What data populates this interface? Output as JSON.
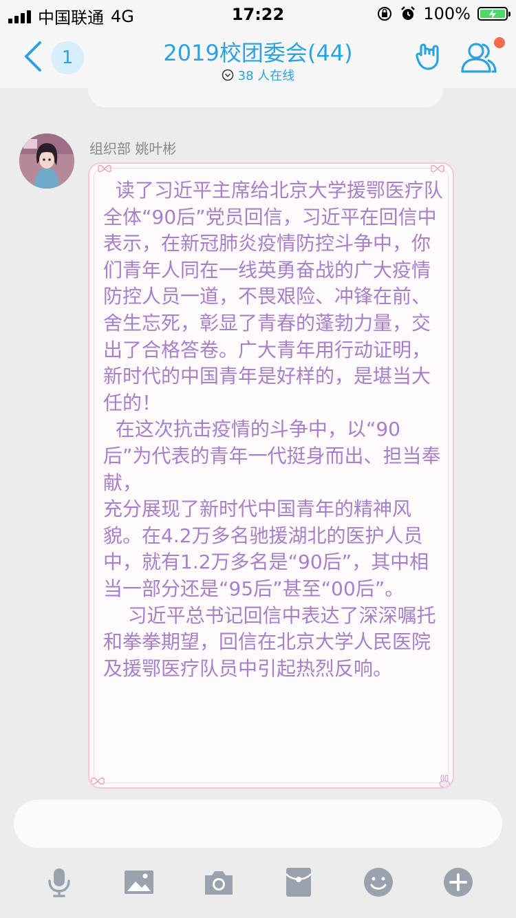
{
  "status_bar": {
    "carrier": "中国联通",
    "network": "4G",
    "time": "17:22",
    "battery": "100%"
  },
  "header": {
    "back_badge": "1",
    "title": "2019校团委会(44)",
    "online": "38 人在线"
  },
  "message": {
    "sender": "组织部 姚叶彬",
    "paragraphs": [
      "  读了习近平主席给北京大学援鄂医疗队全体“90后”党员回信，习近平在回信中表示，在新冠肺炎疫情防控斗争中，你们青年人同在一线英勇奋战的广大疫情防控人员一道，不畏艰险、冲锋在前、舍生忘死，彰显了青春的蓬勃力量，交出了合格答卷。广大青年用行动证明，新时代的中国青年是好样的，是堪当大任的！",
      "  在这次抗击疫情的斗争中，以“90后”为代表的青年一代挺身而出、担当奉献，",
      "充分展现了新时代中国青年的精神风貌。在4.2万多名驰援湖北的医护人员中，就有1.2万多名是“90后”，其中相当一部分还是“95后”甚至“00后”。",
      "    习近平总书记回信中表达了深深嘱托和拳拳期望，回信在北京大学人民医院及援鄂医疗队员中引起热烈反响。"
    ]
  },
  "toolbar": {
    "icons": [
      "microphone-icon",
      "image-icon",
      "camera-icon",
      "red-packet-icon",
      "emoji-icon",
      "plus-icon"
    ]
  },
  "colors": {
    "accent": "#2ba3e0",
    "message_text": "#a87fc9",
    "bubble_border": "#f3c9d6",
    "notification_dot": "#f26b4e",
    "tool_icon": "#9aa3ad"
  }
}
